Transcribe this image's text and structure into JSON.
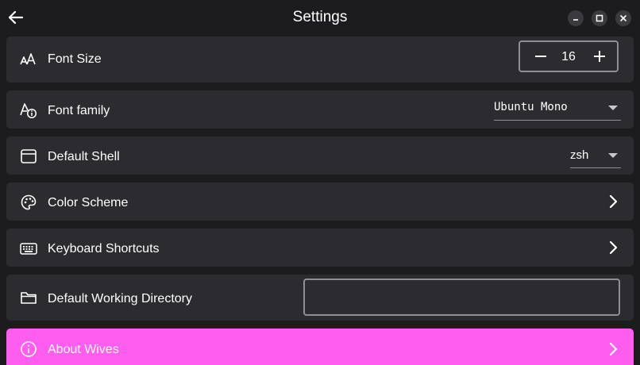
{
  "window": {
    "title": "Settings",
    "controls": [
      "minimize",
      "maximize",
      "close"
    ]
  },
  "settings": {
    "font_size": {
      "label": "Font Size",
      "icon": "text-size-icon",
      "value": "16"
    },
    "font_family": {
      "label": "Font family",
      "icon": "font-info-icon",
      "value": "Ubuntu Mono"
    },
    "default_shell": {
      "label": "Default Shell",
      "icon": "window-icon",
      "value": "zsh"
    },
    "color_scheme": {
      "label": "Color Scheme",
      "icon": "palette-icon"
    },
    "keyboard_shortcuts": {
      "label": "Keyboard Shortcuts",
      "icon": "keyboard-icon"
    },
    "working_directory": {
      "label": "Default Working Directory",
      "icon": "folder-icon",
      "value": ""
    },
    "about": {
      "label": "About Wives",
      "icon": "info-icon",
      "accent": "#ff5cf0"
    }
  },
  "colors": {
    "background": "#1c1c1e",
    "row": "#2c2c30",
    "accent": "#ff5cf0"
  }
}
